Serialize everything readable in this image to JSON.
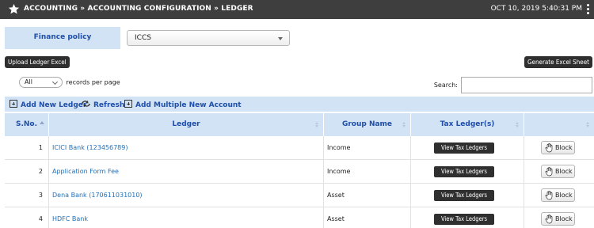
{
  "header": {
    "breadcrumb": "ACCOUNTING » ACCOUNTING CONFIGURATION » LEDGER",
    "datetime": "OCT 10, 2019  5:40:31 PM"
  },
  "filter": {
    "finance_policy_label": "Finance policy",
    "finance_policy_value": "ICCS"
  },
  "actions": {
    "upload_label": "Upload Ledger Excel",
    "generate_label": "Generate Excel Sheet"
  },
  "table_controls": {
    "page_size_value": "All",
    "page_size_suffix": "records per page",
    "search_label": "Search:",
    "search_value": ""
  },
  "toolbar": {
    "add_ledger": "Add New Ledger",
    "refresh": "Refresh",
    "add_multiple": "Add Multiple New Account"
  },
  "columns": [
    "S.No.",
    "Ledger",
    "Group Name",
    "Tax Ledger(s)",
    ""
  ],
  "rows": [
    {
      "sno": "1",
      "ledger": "ICICI Bank (123456789)",
      "group": "Income",
      "tax_btn": "View Tax Ledgers",
      "block_btn": "Block"
    },
    {
      "sno": "2",
      "ledger": "Application Form Fee",
      "group": "Income",
      "tax_btn": "View Tax Ledgers",
      "block_btn": "Block"
    },
    {
      "sno": "3",
      "ledger": "Dena Bank (170611031010)",
      "group": "Asset",
      "tax_btn": "View Tax Ledgers",
      "block_btn": "Block"
    },
    {
      "sno": "4",
      "ledger": "HDFC Bank",
      "group": "Asset",
      "tax_btn": "View Tax Ledgers",
      "block_btn": "Block"
    }
  ],
  "icons": {
    "header": "star-icon",
    "menu": "kebab-menu-icon",
    "add": "plus-box-icon",
    "refresh": "refresh-icon",
    "block": "hand-icon"
  },
  "colors": {
    "header_bg": "#3e3e3e",
    "panel_bg": "#d3e3f6",
    "link": "#1f6fb8",
    "accent_text": "#1f4fa8",
    "dark_button": "#2f2f2f"
  }
}
